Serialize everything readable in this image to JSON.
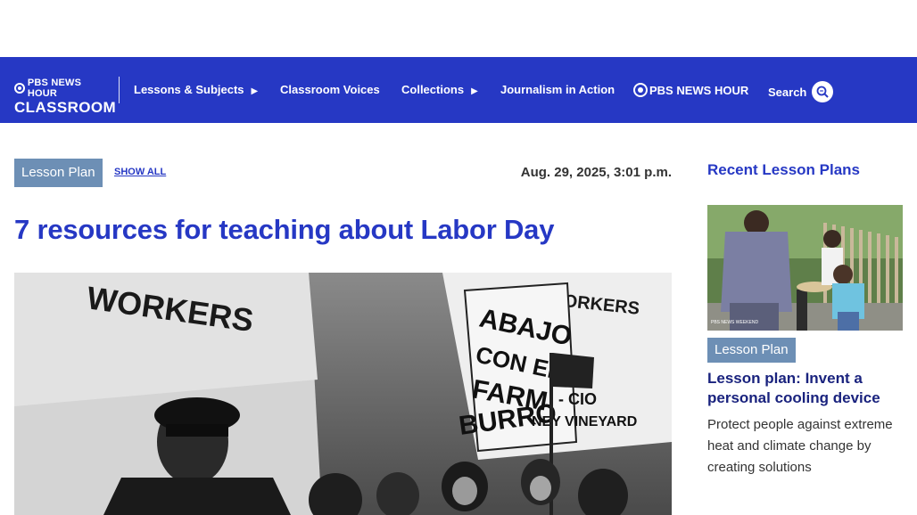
{
  "nav": {
    "logo_line1": "PBS NEWS HOUR",
    "logo_line2": "CLASSROOM",
    "items": [
      {
        "label": "Lessons & Subjects",
        "has_arrow": true
      },
      {
        "label": "Classroom Voices",
        "has_arrow": false
      },
      {
        "label": "Collections",
        "has_arrow": true
      },
      {
        "label": "Journalism in Action",
        "has_arrow": false
      }
    ],
    "arrow_glyph": "▶",
    "newshour_logo": "PBS NEWS HOUR",
    "search_label": "Search",
    "search_icon": "search-icon"
  },
  "article": {
    "tag": "Lesson Plan",
    "show_all": "SHOW ALL",
    "date": "Aug. 29, 2025, 3:01 p.m.",
    "title": "7 resources for teaching about Labor Day",
    "hero_sign_1": "WORKERS",
    "hero_sign_2": "FARMWORKERS",
    "hero_sign_3_lines": [
      "ABAJO",
      "CON EL",
      "FARM",
      "BURRO"
    ],
    "hero_sign_4": "- CIO",
    "hero_sign_5": "NEY VINEYARD"
  },
  "sidebar": {
    "heading": "Recent Lesson Plans",
    "card": {
      "tag": "Lesson Plan",
      "title": "Lesson plan: Invent a personal cooling device",
      "description": "Protect people against extreme heat and climate change by creating solutions",
      "thumb_watermark": "PBS NEWS WEEKEND"
    }
  },
  "colors": {
    "brand_blue": "#2638c4",
    "tag_bg": "#6d8fb5",
    "title_dark": "#1a237e"
  }
}
